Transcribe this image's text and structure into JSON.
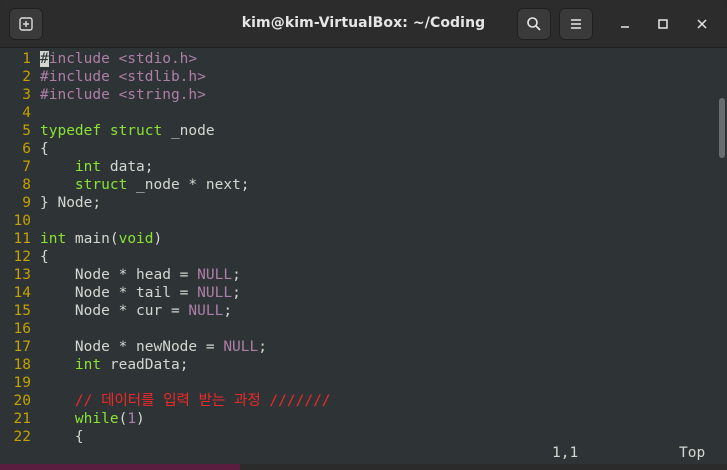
{
  "window": {
    "title": "kim@kim-VirtualBox: ~/Coding"
  },
  "titlebar_icons": {
    "new_tab": "new-tab-icon",
    "search": "search-icon",
    "menu": "hamburger-menu-icon",
    "minimize": "minimize-icon",
    "maximize": "maximize-icon",
    "close": "close-icon"
  },
  "editor": {
    "lines": [
      {
        "n": "1",
        "segs": [
          {
            "t": "#",
            "c": "cursor"
          },
          {
            "t": "include <stdio.h>",
            "c": "pp"
          }
        ]
      },
      {
        "n": "2",
        "segs": [
          {
            "t": "#include <stdlib.h>",
            "c": "pp"
          }
        ]
      },
      {
        "n": "3",
        "segs": [
          {
            "t": "#include <string.h>",
            "c": "pp"
          }
        ]
      },
      {
        "n": "4",
        "segs": []
      },
      {
        "n": "5",
        "segs": [
          {
            "t": "typedef struct",
            "c": "kw"
          },
          {
            "t": " _node",
            "c": ""
          }
        ]
      },
      {
        "n": "6",
        "segs": [
          {
            "t": "{",
            "c": ""
          }
        ]
      },
      {
        "n": "7",
        "segs": [
          {
            "t": "    ",
            "c": ""
          },
          {
            "t": "int",
            "c": "kw"
          },
          {
            "t": " data;",
            "c": ""
          }
        ]
      },
      {
        "n": "8",
        "segs": [
          {
            "t": "    ",
            "c": ""
          },
          {
            "t": "struct",
            "c": "kw"
          },
          {
            "t": " _node * next;",
            "c": ""
          }
        ]
      },
      {
        "n": "9",
        "segs": [
          {
            "t": "} Node;",
            "c": ""
          }
        ]
      },
      {
        "n": "10",
        "segs": []
      },
      {
        "n": "11",
        "segs": [
          {
            "t": "int",
            "c": "kw"
          },
          {
            "t": " main(",
            "c": ""
          },
          {
            "t": "void",
            "c": "kw"
          },
          {
            "t": ")",
            "c": ""
          }
        ]
      },
      {
        "n": "12",
        "segs": [
          {
            "t": "{",
            "c": ""
          }
        ]
      },
      {
        "n": "13",
        "segs": [
          {
            "t": "    Node * head = ",
            "c": ""
          },
          {
            "t": "NULL",
            "c": "const"
          },
          {
            "t": ";",
            "c": ""
          }
        ]
      },
      {
        "n": "14",
        "segs": [
          {
            "t": "    Node * tail = ",
            "c": ""
          },
          {
            "t": "NULL",
            "c": "const"
          },
          {
            "t": ";",
            "c": ""
          }
        ]
      },
      {
        "n": "15",
        "segs": [
          {
            "t": "    Node * cur = ",
            "c": ""
          },
          {
            "t": "NULL",
            "c": "const"
          },
          {
            "t": ";",
            "c": ""
          }
        ]
      },
      {
        "n": "16",
        "segs": []
      },
      {
        "n": "17",
        "segs": [
          {
            "t": "    Node * newNode = ",
            "c": ""
          },
          {
            "t": "NULL",
            "c": "const"
          },
          {
            "t": ";",
            "c": ""
          }
        ]
      },
      {
        "n": "18",
        "segs": [
          {
            "t": "    ",
            "c": ""
          },
          {
            "t": "int",
            "c": "kw"
          },
          {
            "t": " readData;",
            "c": ""
          }
        ]
      },
      {
        "n": "19",
        "segs": []
      },
      {
        "n": "20",
        "segs": [
          {
            "t": "    ",
            "c": ""
          },
          {
            "t": "// 데이터를 입력 받는 과정 ///////",
            "c": "cmt"
          }
        ]
      },
      {
        "n": "21",
        "segs": [
          {
            "t": "    ",
            "c": ""
          },
          {
            "t": "while",
            "c": "kw"
          },
          {
            "t": "(",
            "c": ""
          },
          {
            "t": "1",
            "c": "num"
          },
          {
            "t": ")",
            "c": ""
          }
        ]
      },
      {
        "n": "22",
        "segs": [
          {
            "t": "    {",
            "c": ""
          }
        ]
      }
    ]
  },
  "statusline": {
    "position": "1,1",
    "scroll": "Top"
  },
  "colors": {
    "background": "#2e3436",
    "line_number": "#c4a000",
    "keyword": "#8ae234",
    "preprocessor": "#ad7fa8",
    "comment": "#ef2929"
  }
}
